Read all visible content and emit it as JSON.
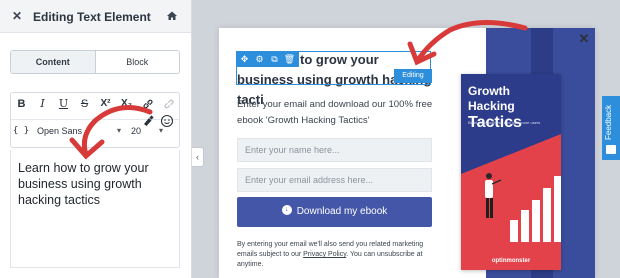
{
  "panel": {
    "title": "Editing Text Element",
    "close_icon": "close-icon",
    "home_icon": "home-icon",
    "tabs": [
      {
        "label": "Content",
        "active": true
      },
      {
        "label": "Block",
        "active": false
      }
    ],
    "toolbar": {
      "bold": "B",
      "italic": "I",
      "underline": "U",
      "strike": "S",
      "superscript": "X²",
      "subscript": "X₂",
      "source": "{ }",
      "font": "Open Sans",
      "size": "20"
    },
    "editor_text": "Learn how to grow your business using growth hacking tactics"
  },
  "popup": {
    "headline": "Learn how to grow your business using growth hacking tactics",
    "headline_visible": "to grow your business using growth hacking tacti",
    "editing_badge": "Editing",
    "description": "Enter your email and download our 100% free ebook 'Growth Hacking Tactics'",
    "name_placeholder": "Enter your name here...",
    "email_placeholder": "Enter your email address here...",
    "cta_label": "Download my ebook",
    "fine_print_1": "By entering your email we'll also send you related marketing emails subject to our ",
    "privacy_link": "Privacy Policy",
    "fine_print_2": ". You can unsubscribe at anytime.",
    "ebook": {
      "title_line1": "Growth Hacking",
      "title_line2": "Tactics",
      "subtitle": "Build your business and gain more users",
      "logo": "optinmonster"
    }
  },
  "feedback_label": "Feedback",
  "colors": {
    "accent_blue": "#2d8fdc",
    "cta_blue": "#4456a8",
    "ebook_navy": "#2c3c8a",
    "ebook_red": "#e4424a",
    "arrow_red": "#d83a3a"
  }
}
